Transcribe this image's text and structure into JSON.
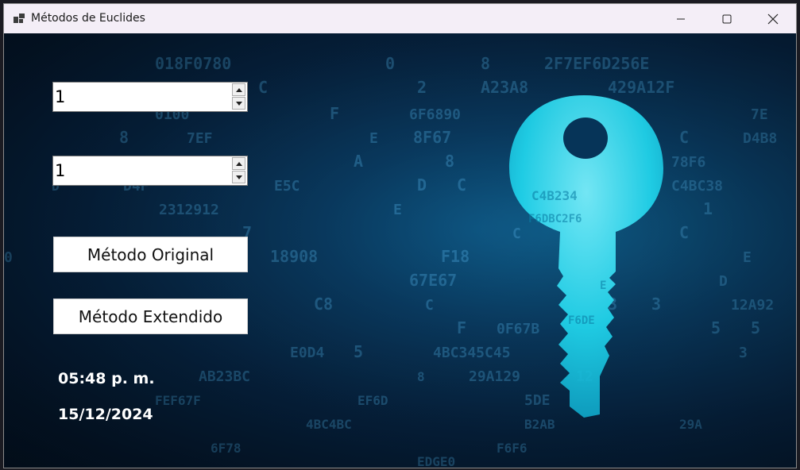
{
  "window": {
    "title": "Métodos de Euclides",
    "icon": "app-window-icon",
    "controls": [
      "minimize-icon",
      "maximize-icon",
      "close-icon"
    ]
  },
  "inputs": {
    "first_value": "1",
    "second_value": "1"
  },
  "buttons": {
    "original": "Método Original",
    "extended": "Método Extendido"
  },
  "status": {
    "time": "05:48 p. m.",
    "date": "15/12/2024"
  },
  "background": {
    "image": "digital-key-background",
    "accent": "#21d7ee",
    "dark": "#041428"
  }
}
